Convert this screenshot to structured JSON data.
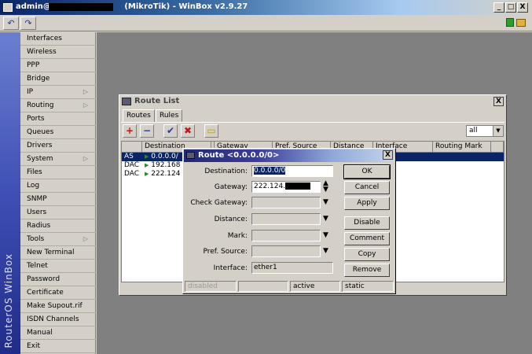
{
  "window": {
    "title": "admin@... (MikroTik) - WinBox v2.9.27",
    "title_prefix": "admin@",
    "title_suffix": " (MikroTik) - WinBox v2.9.27",
    "buttons": [
      "_",
      "□",
      "X"
    ]
  },
  "toolbar": {
    "undo_icon": "undo-icon",
    "redo_icon": "redo-icon",
    "lock_icon": "lock-icon"
  },
  "sidebar": {
    "brand": "RouterOS WinBox",
    "items": [
      {
        "label": "Interfaces"
      },
      {
        "label": "Wireless"
      },
      {
        "label": "PPP"
      },
      {
        "label": "Bridge"
      },
      {
        "label": "IP",
        "submenu": true
      },
      {
        "label": "Routing",
        "submenu": true
      },
      {
        "label": "Ports"
      },
      {
        "label": "Queues"
      },
      {
        "label": "Drivers"
      },
      {
        "label": "System",
        "submenu": true
      },
      {
        "label": "Files"
      },
      {
        "label": "Log"
      },
      {
        "label": "SNMP"
      },
      {
        "label": "Users"
      },
      {
        "label": "Radius"
      },
      {
        "label": "Tools",
        "submenu": true
      },
      {
        "label": "New Terminal"
      },
      {
        "label": "Telnet"
      },
      {
        "label": "Password"
      },
      {
        "label": "Certificate"
      },
      {
        "label": "Make Supout.rif"
      },
      {
        "label": "ISDN Channels"
      },
      {
        "label": "Manual"
      },
      {
        "label": "Exit"
      }
    ]
  },
  "route_list": {
    "title": "Route List",
    "close": "X",
    "tabs": [
      "Routes",
      "Rules"
    ],
    "toolbar": {
      "add": "+",
      "remove": "−",
      "enable": "✔",
      "disable": "✖",
      "comment": "▭"
    },
    "filter": "all",
    "columns": [
      "",
      "Destination",
      "/",
      "Gateway",
      "Pref. Source",
      "Distance",
      "Interface",
      "Routing Mark"
    ],
    "rows": [
      {
        "flag": "AS",
        "destination": "0.0.0.0/",
        "selected": true
      },
      {
        "flag": "DAC",
        "destination": "192.168"
      },
      {
        "flag": "DAC",
        "destination": "222.124"
      }
    ]
  },
  "route_dialog": {
    "title": "Route <0.0.0.0/0>",
    "close": "X",
    "fields": [
      {
        "label": "Destination:",
        "value": "0.0.0.0/0"
      },
      {
        "label": "Gateway:",
        "value": "222.124."
      },
      {
        "label": "Check Gateway:",
        "value": ""
      },
      {
        "label": "Distance:",
        "value": ""
      },
      {
        "label": "Mark:",
        "value": ""
      },
      {
        "label": "Pref. Source:",
        "value": ""
      },
      {
        "label": "Interface:",
        "value": "ether1"
      }
    ],
    "buttons": [
      "OK",
      "Cancel",
      "Apply",
      "Disable",
      "Comment",
      "Copy",
      "Remove"
    ],
    "status": [
      "disabled",
      "",
      "active",
      "static"
    ]
  }
}
